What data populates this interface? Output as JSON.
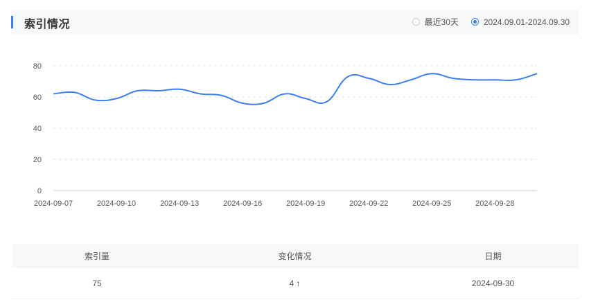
{
  "header": {
    "title": "索引情况",
    "options": [
      {
        "label": "最近30天",
        "checked": false
      },
      {
        "label": "2024.09.01-2024.09.30",
        "checked": true
      }
    ]
  },
  "chart_data": {
    "type": "line",
    "title": "",
    "xlabel": "",
    "ylabel": "",
    "ylim": [
      0,
      80
    ],
    "yticks": [
      0,
      20,
      40,
      60,
      80
    ],
    "grid": true,
    "line_color": "#3b7ef0",
    "x": [
      "2024-09-07",
      "2024-09-08",
      "2024-09-09",
      "2024-09-10",
      "2024-09-11",
      "2024-09-12",
      "2024-09-13",
      "2024-09-14",
      "2024-09-15",
      "2024-09-16",
      "2024-09-17",
      "2024-09-18",
      "2024-09-19",
      "2024-09-20",
      "2024-09-21",
      "2024-09-22",
      "2024-09-23",
      "2024-09-24",
      "2024-09-25",
      "2024-09-26",
      "2024-09-27",
      "2024-09-28",
      "2024-09-29",
      "2024-09-30"
    ],
    "x_tick_labels": [
      "2024-09-07",
      "2024-09-10",
      "2024-09-13",
      "2024-09-16",
      "2024-09-19",
      "2024-09-22",
      "2024-09-25",
      "2024-09-28"
    ],
    "series": [
      {
        "values": [
          62,
          63,
          58,
          59,
          64,
          64,
          65,
          62,
          61,
          56,
          56,
          62,
          59,
          57,
          73,
          72,
          68,
          71,
          75,
          72,
          71,
          71,
          71,
          75
        ]
      }
    ]
  },
  "table": {
    "headers": [
      "索引量",
      "变化情况",
      "日期"
    ],
    "row": {
      "count": "75",
      "change": "4",
      "change_arrow": "↑",
      "date": "2024-09-30"
    }
  }
}
